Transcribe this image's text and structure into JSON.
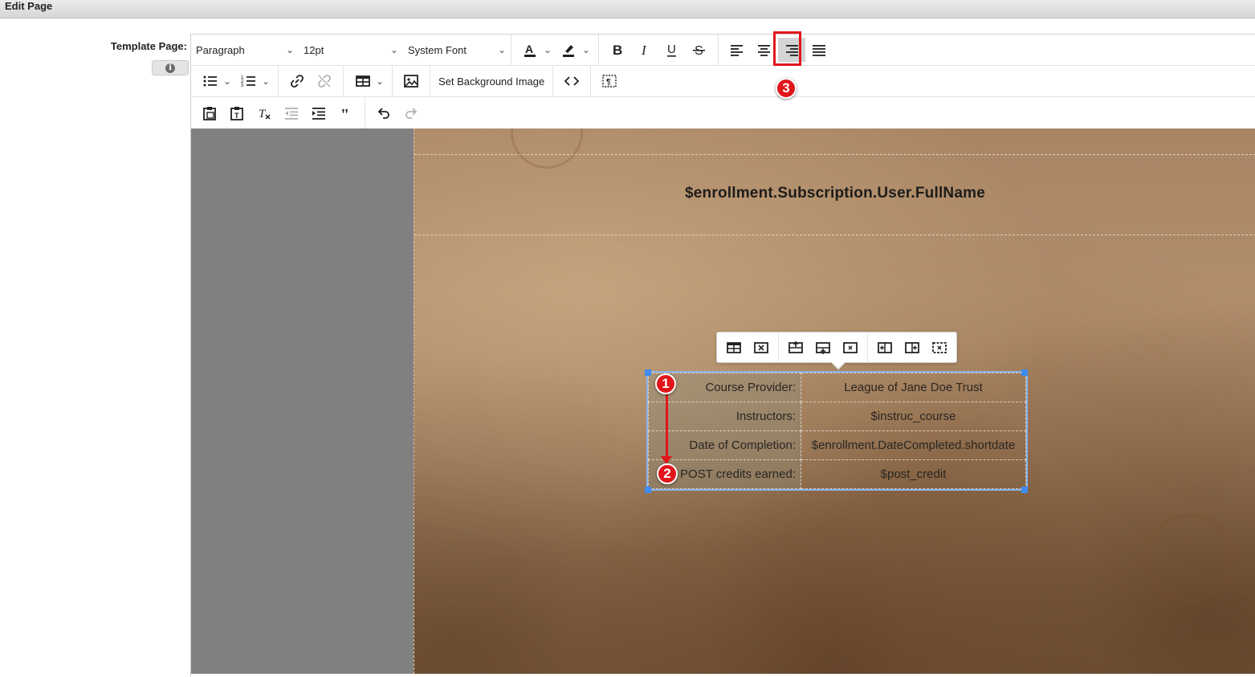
{
  "window": {
    "title": "Edit Page"
  },
  "form": {
    "field_label": "Template Page:",
    "info_icon": "info-icon",
    "info_glyph": "i"
  },
  "toolbar": {
    "block_format": "Paragraph",
    "font_size": "12pt",
    "font_family": "System Font",
    "set_background_label": "Set Background Image",
    "active_button": "align-right",
    "icons": {
      "text_color": "text-color-icon",
      "highlight": "highlight-icon",
      "bold": "bold-icon",
      "italic": "italic-icon",
      "underline": "underline-icon",
      "strikethrough": "strikethrough-icon",
      "align_left": "align-left-icon",
      "align_center": "align-center-icon",
      "align_right": "align-right-icon",
      "justify": "justify-icon",
      "bullet_list": "bullet-list-icon",
      "numbered_list": "numbered-list-icon",
      "link": "link-icon",
      "unlink": "unlink-icon",
      "table": "table-icon",
      "image": "image-icon",
      "source_code": "source-code-icon",
      "show_blocks": "show-blocks-icon",
      "paste": "paste-icon",
      "paste_text": "paste-as-text-icon",
      "clear_format": "clear-formatting-icon",
      "outdent": "outdent-icon",
      "indent": "indent-icon",
      "blockquote": "blockquote-icon",
      "undo": "undo-icon",
      "redo": "redo-icon"
    }
  },
  "document": {
    "title": "$enrollment.Subscription.User.FullName",
    "table": [
      {
        "label": "Course Provider:",
        "value": "League of Jane Doe Trust"
      },
      {
        "label": "Instructors:",
        "value": "$instruc_course"
      },
      {
        "label": "Date of Completion:",
        "value": "$enrollment.DateCompleted.shortdate"
      },
      {
        "label": "POST credits earned:",
        "value": "$post_credit"
      }
    ]
  },
  "table_toolbar": {
    "icons": [
      "table-properties-icon",
      "delete-table-icon",
      "insert-row-before-icon",
      "insert-row-after-icon",
      "delete-row-icon",
      "insert-column-before-icon",
      "insert-column-after-icon",
      "delete-column-icon"
    ]
  },
  "annotations": {
    "badge_1": "1",
    "badge_2": "2",
    "badge_3": "3",
    "color": "#e1151a"
  },
  "colors": {
    "accent": "#e1151a",
    "selection": "#3f8cf2",
    "canvas_gray": "#808080"
  }
}
